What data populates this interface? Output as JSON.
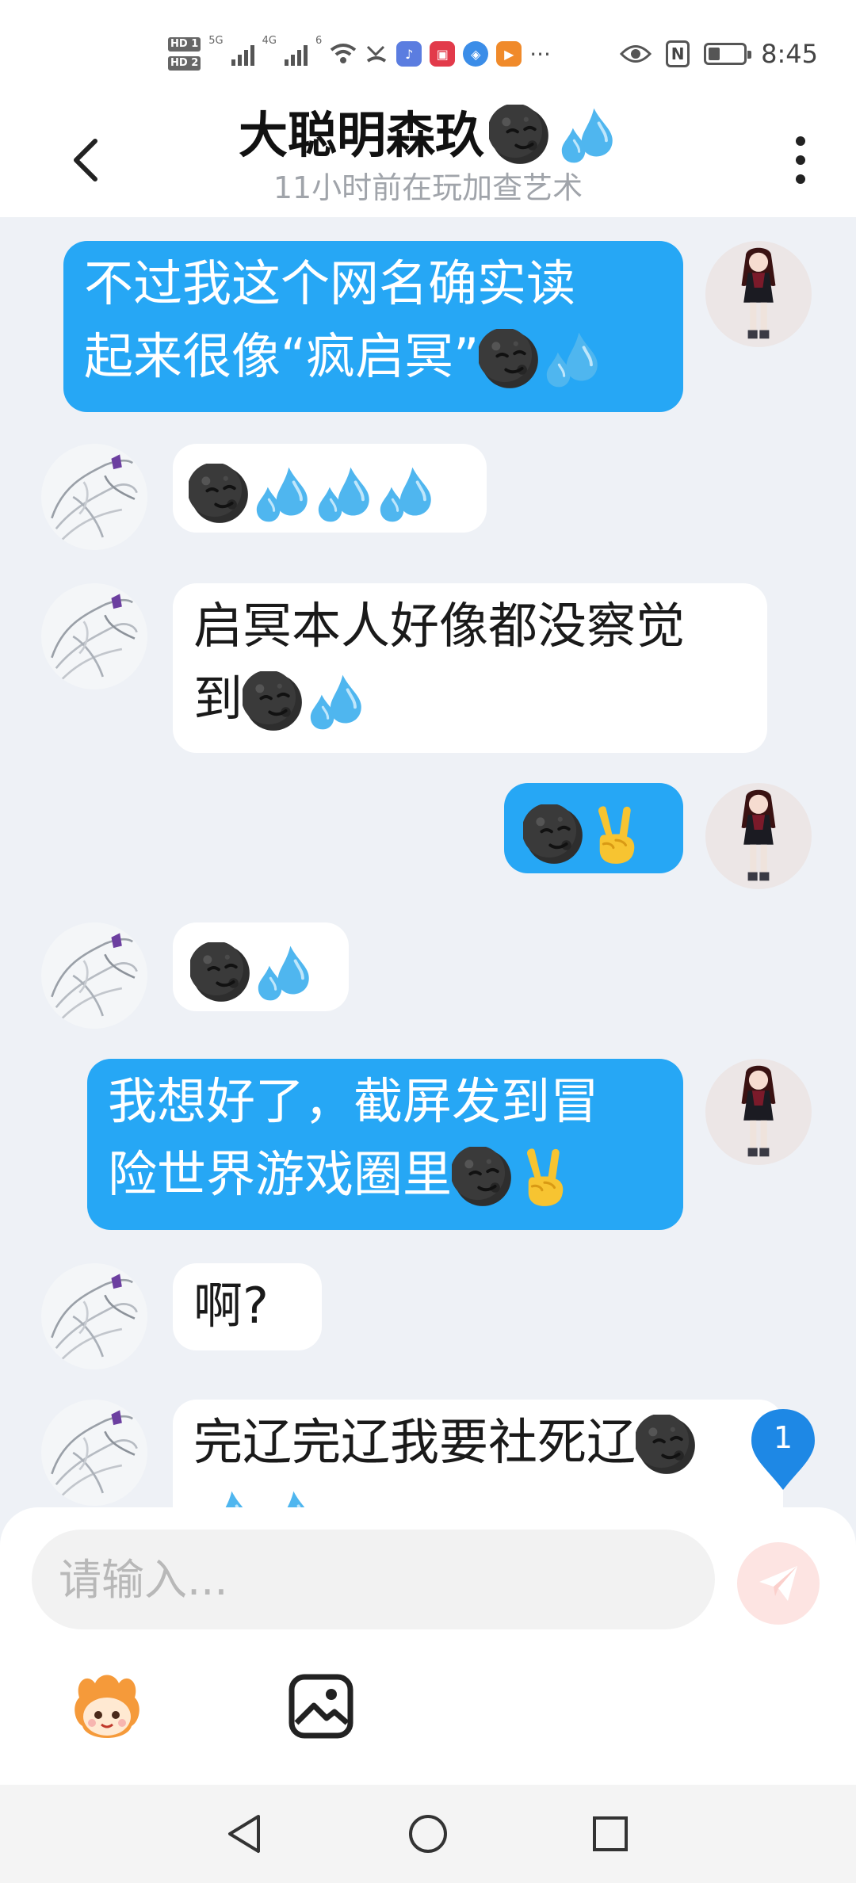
{
  "status_bar": {
    "hd1": "HD 1",
    "hd2": "HD 2",
    "net1": "5G",
    "net2": "4G",
    "wifi_num": "6",
    "time": "8:45",
    "nfc": "N"
  },
  "header": {
    "title": "大聪明森玖",
    "subtitle": "11小时前在玩加查艺术"
  },
  "messages": [
    {
      "side": "sent",
      "lines": [
        "不过我这个网名确实读",
        "起来很像“疯启冥”"
      ]
    },
    {
      "side": "recv",
      "text": ""
    },
    {
      "side": "recv",
      "lines": [
        "启冥本人好像都没察觉",
        "到"
      ]
    },
    {
      "side": "sent",
      "text": ""
    },
    {
      "side": "recv",
      "text": ""
    },
    {
      "side": "sent",
      "lines": [
        "我想好了，截屏发到冒",
        "险世界游戏圈里"
      ]
    },
    {
      "side": "recv",
      "text": "啊?"
    },
    {
      "side": "recv",
      "text": "完辽完辽我要社死辽"
    }
  ],
  "unread_badge": "1",
  "input": {
    "placeholder": "请输入..."
  },
  "colors": {
    "sent_bubble": "#26a7f5",
    "recv_bubble": "#ffffff",
    "background": "#eef1f6",
    "badge": "#1e88e5"
  },
  "icons": [
    "back-icon",
    "more-icon",
    "moon-face-emoji",
    "sweat-droplets-emoji",
    "victory-hand-emoji",
    "send-icon",
    "sticker-icon",
    "image-icon",
    "nav-back-icon",
    "nav-home-icon",
    "nav-recents-icon"
  ]
}
